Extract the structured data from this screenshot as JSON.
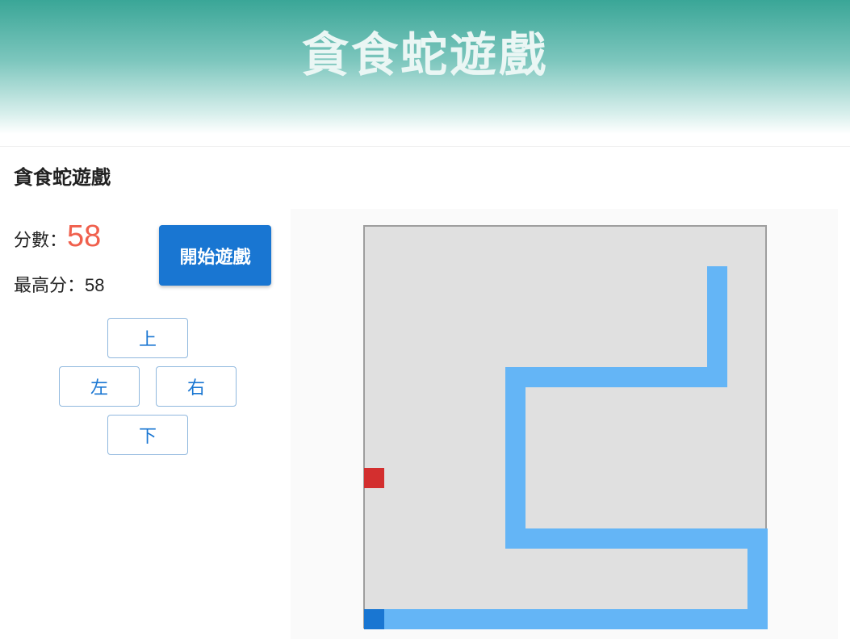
{
  "header": {
    "title": "貪食蛇遊戲"
  },
  "section": {
    "title": "貪食蛇遊戲"
  },
  "score": {
    "label": "分數：",
    "value": "58"
  },
  "best": {
    "label": "最高分：",
    "value": "58"
  },
  "controls": {
    "start_label": "開始遊戲",
    "up_label": "上",
    "left_label": "左",
    "right_label": "右",
    "down_label": "下"
  },
  "colors": {
    "snake_body": "#64b5f6",
    "snake_head": "#1976d2",
    "food": "#d32f2f",
    "board_bg": "#e0e0e0",
    "accent": "#1976d2",
    "score_value": "#f0604d"
  },
  "game": {
    "grid_cols": 20,
    "grid_rows": 20,
    "food": {
      "col": 0,
      "row": 12
    },
    "snake_head": {
      "col": 0,
      "row": 19
    },
    "snake_path": [
      {
        "col": 0,
        "row": 19
      },
      {
        "col": 19,
        "row": 19
      },
      {
        "col": 19,
        "row": 15
      },
      {
        "col": 7,
        "row": 15
      },
      {
        "col": 7,
        "row": 7
      },
      {
        "col": 17,
        "row": 7
      },
      {
        "col": 17,
        "row": 2
      }
    ]
  }
}
